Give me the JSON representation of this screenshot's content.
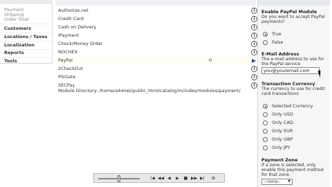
{
  "nav": {
    "top_partial": "",
    "subitems": [
      "Payment",
      "Shipping",
      "Order Total"
    ],
    "items": [
      "Customers",
      "Locations / Taxes",
      "Localization",
      "Reports",
      "Tools"
    ]
  },
  "modules": {
    "rows": [
      {
        "name": "Authorize.net",
        "sort": ""
      },
      {
        "name": "Credit Card",
        "sort": ""
      },
      {
        "name": "Cash on Delivery",
        "sort": ""
      },
      {
        "name": "iPayment",
        "sort": ""
      },
      {
        "name": "Check/Money Order",
        "sort": ""
      },
      {
        "name": "NOCHEX",
        "sort": ""
      },
      {
        "name": "PayPal",
        "sort": "0"
      },
      {
        "name": "2CheckOut",
        "sort": ""
      },
      {
        "name": "PSiGate",
        "sort": ""
      },
      {
        "name": "SECPay",
        "sort": ""
      }
    ],
    "directory": "Module Directory: /home/a44net/public_html/catalog/includes/modules/payment/",
    "info_icon": "info-icon",
    "arrow_icon": "arrow-right-icon"
  },
  "panel": {
    "enable_title": "Enable PayPal Module",
    "enable_desc": "Do you want to accept PayPal payments?",
    "enable_options": [
      "True",
      "False"
    ],
    "enable_selected": "True",
    "email_title": "E-Mail Address",
    "email_desc": "The e-mail address to use for the PayPal service",
    "email_value": "you@youremail.com",
    "currency_title": "Transaction Currency",
    "currency_desc": "The currency to use for credit card transactions",
    "currency_options": [
      "Selected Currency",
      "Only USD",
      "Only CAD",
      "Only EUR",
      "Only GBP",
      "Only JPY"
    ],
    "currency_selected": "Selected Currency",
    "zone_title": "Payment Zone",
    "zone_desc": "If a zone is selected, only enable this payment method for that zone.",
    "zone_select": "--none--"
  },
  "toolbar": {
    "buttons": [
      "|◀",
      "◀◀",
      "◀",
      "▶",
      "■",
      "▶▶",
      "▶|",
      "⊞"
    ]
  }
}
